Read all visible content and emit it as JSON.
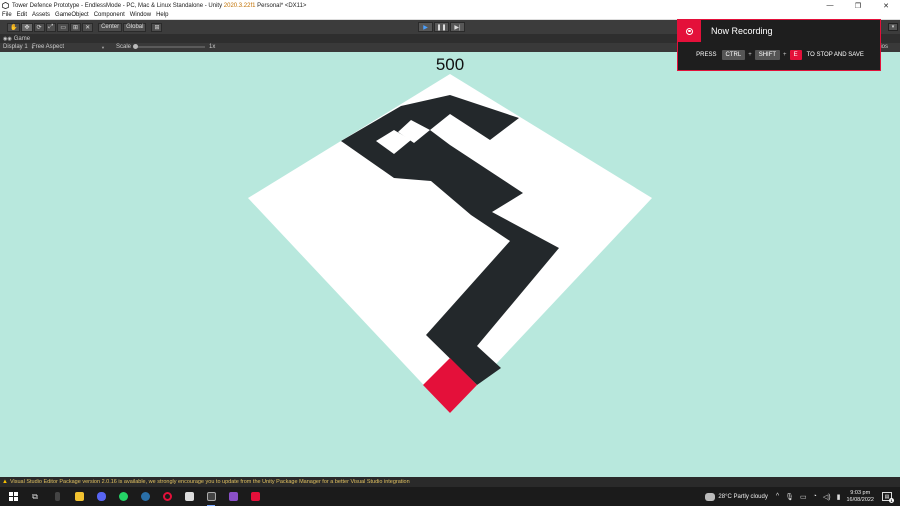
{
  "window": {
    "title_prefix": "Tower Defence Prototype - EndlessMode - PC, Mac & Linux Standalone - Unity ",
    "title_version": "2020.3.22f1",
    "title_suffix": " Personal* <DX11>",
    "minimize": "—",
    "maximize": "❐",
    "close": "✕"
  },
  "menu": [
    "File",
    "Edit",
    "Assets",
    "GameObject",
    "Component",
    "Window",
    "Help"
  ],
  "toolbar": {
    "tools": [
      "✋",
      "✥",
      "⟳",
      "⤢",
      "▭",
      "⊞",
      "✕"
    ],
    "pivot_label": "Center",
    "space_label": "Global",
    "snap_label": "⊞",
    "play": "▶",
    "pause": "❚❚",
    "step": "▶|",
    "right": "▾"
  },
  "game_tab": {
    "label": "Game",
    "icon": "game-controller-icon"
  },
  "game_toolbar": {
    "display": "Display 1",
    "aspect": "Free Aspect",
    "scale_label": "Scale",
    "scale_value": "1x",
    "right_tag": "ios"
  },
  "game": {
    "score": "500",
    "colors": {
      "background": "#b8e8dd",
      "board": "#ffffff",
      "path": "#23282b",
      "base": "#e4103a"
    }
  },
  "recording": {
    "title": "Now Recording",
    "press": "PRESS",
    "key1": "CTRL",
    "key2": "SHIFT",
    "key3": "E",
    "plus": "+",
    "action": "TO STOP AND SAVE",
    "accent": "#e4103a"
  },
  "status": {
    "icon": "warning-icon",
    "message": "Visual Studio Editor Package version 2.0.16 is available, we strongly encourage you to update from the Unity Package Manager for a better Visual Studio integration"
  },
  "taskbar": {
    "apps": [
      {
        "name": "task-view-icon",
        "glyph": "⧉",
        "color": "#dddddd"
      },
      {
        "name": "search-icon",
        "glyph": "▯",
        "color": "#555555"
      },
      {
        "name": "file-explorer-icon",
        "glyph": "",
        "color": "#f2c230"
      },
      {
        "name": "discord-icon",
        "glyph": "",
        "color": "#5865f2"
      },
      {
        "name": "whatsapp-icon",
        "glyph": "",
        "color": "#25d366"
      },
      {
        "name": "steam-icon",
        "glyph": "",
        "color": "#2a6fa8"
      },
      {
        "name": "opera-icon",
        "glyph": "",
        "color": "#e4103a"
      },
      {
        "name": "unity-hub-icon",
        "glyph": "",
        "color": "#dddddd"
      },
      {
        "name": "unity-editor-icon",
        "glyph": "",
        "color": "#444444"
      },
      {
        "name": "visual-studio-icon",
        "glyph": "",
        "color": "#8a4fc8"
      },
      {
        "name": "recorder-app-icon",
        "glyph": "",
        "color": "#e4103a"
      }
    ],
    "weather": "28°C  Partly cloudy",
    "tray_chevron": "^",
    "time": "9:03 pm",
    "date": "16/08/2022",
    "notifications": "1"
  }
}
